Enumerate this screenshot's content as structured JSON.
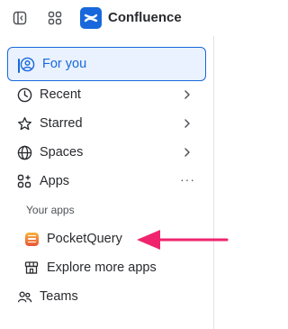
{
  "header": {
    "app_name": "Confluence"
  },
  "nav": {
    "for_you": "For you",
    "recent": "Recent",
    "starred": "Starred",
    "spaces": "Spaces",
    "apps": "Apps",
    "apps_more": "···",
    "your_apps_heading": "Your apps",
    "pocketquery": "PocketQuery",
    "explore": "Explore more apps",
    "teams": "Teams"
  },
  "colors": {
    "accent": "#1868db",
    "active_bg": "#e9f2fe",
    "annotation_arrow": "#f0246e"
  },
  "icons": [
    "sidebar-toggle-icon",
    "app-switcher-icon",
    "confluence-logo-icon",
    "person-icon",
    "clock-icon",
    "star-icon",
    "globe-icon",
    "apps-icon",
    "pocketquery-icon",
    "store-icon",
    "teams-icon",
    "chevron-right-icon"
  ]
}
